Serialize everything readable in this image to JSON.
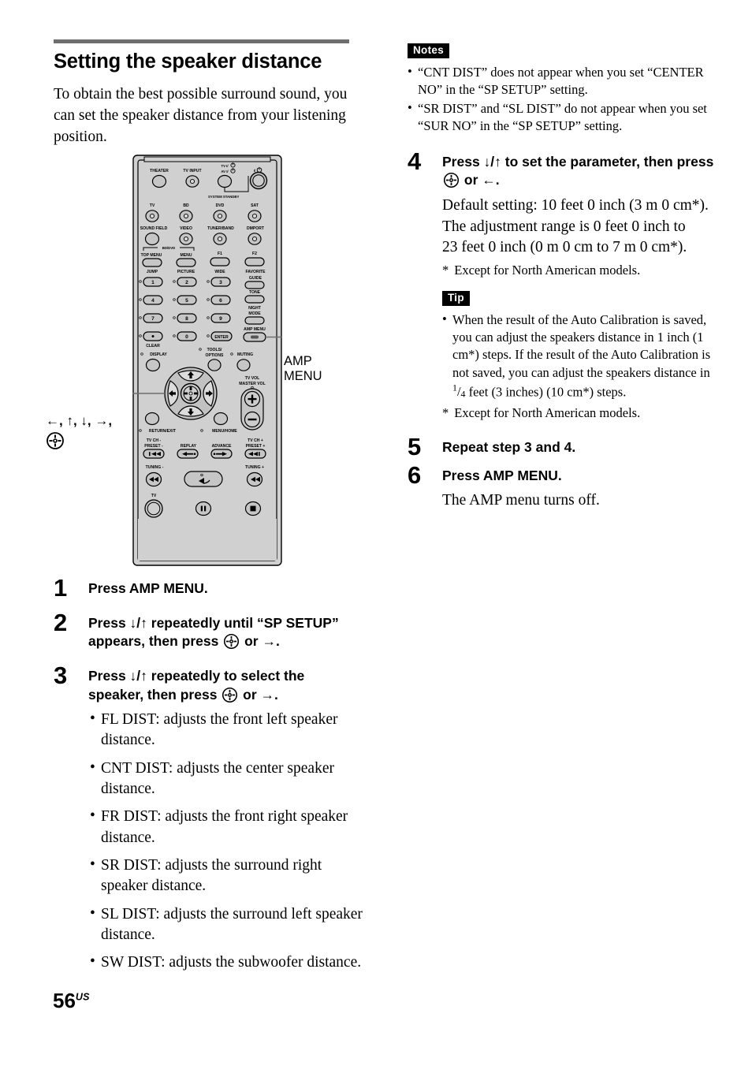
{
  "page": {
    "number": "56",
    "region_suffix": "US"
  },
  "section": {
    "title": "Setting the speaker distance",
    "intro": "To obtain the best possible surround sound, you can set the speaker distance from your listening position."
  },
  "figure": {
    "callout_amp_menu_line1": "AMP",
    "callout_amp_menu_line2": "MENU",
    "callout_arrows": "←, ↑, ↓, →,",
    "remote": {
      "row_labels_top": [
        "THEATER",
        "TV INPUT"
      ],
      "power_labels": [
        "TV I/⏻",
        "AV I/⏻",
        "I/⏻"
      ],
      "system_standby": "SYSTEM STANDBY",
      "input_row1": [
        "TV",
        "BD",
        "DVD",
        "SAT"
      ],
      "input_row2": [
        "SOUND FIELD",
        "VIDEO",
        "TUNER/BAND",
        "DMPORT"
      ],
      "bd_dvd_bracket": "BD/DVD",
      "func_row_top": [
        "TOP MENU",
        "MENU",
        "F1",
        "F2"
      ],
      "func_row_bottom": [
        "JUMP",
        "PICTURE",
        "WIDE",
        "FAVORITE"
      ],
      "favorite_guide": "GUIDE",
      "right_column": [
        "TONE",
        "NIGHT",
        "MODE"
      ],
      "numbers": [
        "1",
        "2",
        "3",
        "4",
        "5",
        "6",
        "7",
        "8",
        "9",
        "·",
        "0",
        "ENTER"
      ],
      "clear": "CLEAR",
      "amp_menu": "AMP MENU",
      "display": "DISPLAY",
      "tools_options_line1": "TOOLS/",
      "tools_options_line2": "OPTIONS",
      "muting": "MUTING",
      "tv_vol_line1": "TV VOL",
      "tv_vol_line2": "MASTER VOL",
      "vol_plus": "+",
      "vol_minus": "−",
      "return_exit": "RETURN/EXIT",
      "menu_home": "MENU/HOME",
      "transport_top": [
        "TV CH -",
        "PRESET -",
        "REPLAY",
        "ADVANCE",
        "TV CH +",
        "PRESET +"
      ],
      "tuning_minus": "TUNING -",
      "tuning_plus": "TUNING +",
      "tv_bottom": "TV"
    }
  },
  "steps_left": [
    {
      "num": "1",
      "head": "Press AMP MENU."
    },
    {
      "num": "2",
      "head_part1": "Press ↓/↑ repeatedly until “SP SETUP” appears, then press",
      "head_part2": "or →."
    },
    {
      "num": "3",
      "head_part1": "Press ↓/↑ repeatedly to select the speaker, then press",
      "head_part2": "or →.",
      "bullets": [
        "FL DIST: adjusts the front left speaker distance.",
        "CNT DIST: adjusts the center speaker distance.",
        "FR DIST: adjusts the front right speaker distance.",
        "SR DIST: adjusts the surround right speaker distance.",
        "SL DIST: adjusts the surround left speaker distance.",
        "SW DIST: adjusts the subwoofer distance."
      ]
    }
  ],
  "notes": {
    "badge": "Notes",
    "items": [
      "“CNT DIST” does not appear when you set “CENTER NO” in the “SP SETUP” setting.",
      "“SR DIST” and “SL DIST” do not appear when you set “SUR NO” in the “SP SETUP” setting."
    ]
  },
  "step4": {
    "num": "4",
    "head_part1": "Press ↓/↑ to set the parameter, then press",
    "head_part2": "or ←.",
    "body_lines": [
      "Default setting: 10 feet 0 inch (3 m 0 cm*).",
      "The adjustment range is 0 feet 0 inch to",
      "23 feet 0 inch (0 m 0 cm to 7 m 0 cm*)."
    ],
    "footnote_star": "*",
    "footnote_text": "Except for North American models."
  },
  "tip": {
    "badge": "Tip",
    "text_before_frac": "When the result of the Auto Calibration is saved, you can adjust the speakers distance in 1 inch (1 cm*) steps. If the result of the Auto Calibration is not saved, you can adjust the speakers distance in ",
    "fraction": "1/4",
    "text_after_frac": " feet (3 inches) (10 cm*) steps.",
    "footnote_star": "*",
    "footnote_text": "Except for North American models."
  },
  "step5": {
    "num": "5",
    "head": "Repeat step 3 and 4."
  },
  "step6": {
    "num": "6",
    "head": "Press AMP MENU.",
    "body": "The AMP menu turns off."
  }
}
